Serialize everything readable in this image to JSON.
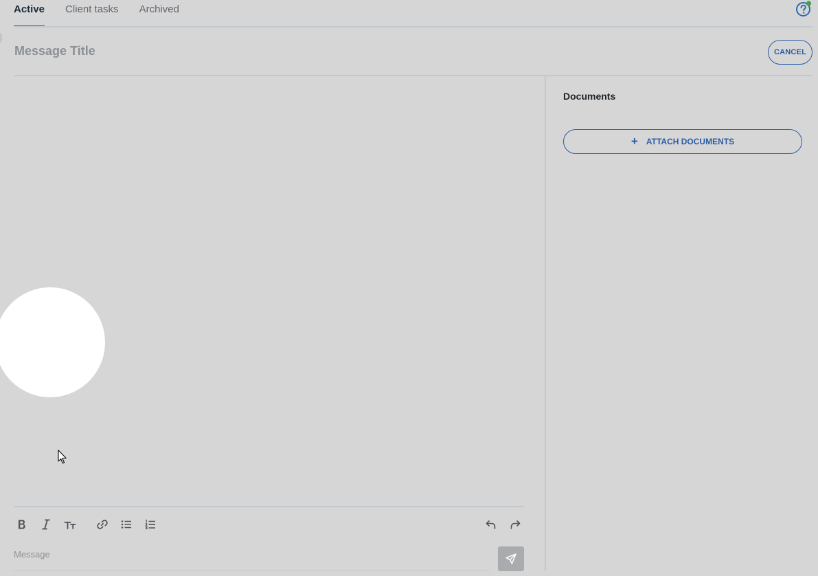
{
  "tabs": [
    {
      "label": "Active",
      "active": true
    },
    {
      "label": "Client tasks",
      "active": false
    },
    {
      "label": "Archived",
      "active": false
    }
  ],
  "header": {
    "help_icon": "help-question-icon",
    "status_dot_color": "#3aa34a"
  },
  "compose": {
    "title_placeholder": "Message Title",
    "cancel_label": "CANCEL",
    "message_placeholder": "Message"
  },
  "toolbar": {
    "icons": [
      "bold-icon",
      "italic-icon",
      "text-size-icon",
      "link-icon",
      "bullet-list-icon",
      "numbered-list-icon",
      "undo-icon",
      "redo-icon"
    ]
  },
  "documents": {
    "title": "Documents",
    "attach_label": "ATTACH DOCUMENTS",
    "attach_icon": "plus-icon"
  },
  "colors": {
    "background": "#d6d6d6",
    "accent": "#2a5da6",
    "send_button": "#a9abae"
  }
}
